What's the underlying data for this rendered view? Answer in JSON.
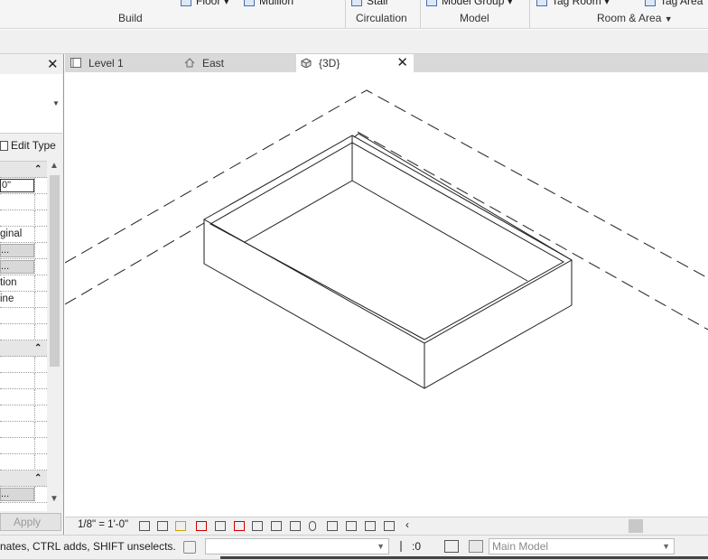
{
  "ribbon": {
    "partial_items": [
      {
        "label": "Floor",
        "icon": "floor-icon",
        "dropdown": true
      },
      {
        "label": "Mullion",
        "icon": "mullion-icon",
        "dropdown": false
      },
      {
        "label": "Stair",
        "icon": "stair-icon",
        "dropdown": false
      },
      {
        "label": "Model Group",
        "icon": "model-group-icon",
        "dropdown": true
      },
      {
        "label": "Tag Room",
        "icon": "tag-room-icon",
        "dropdown": true
      },
      {
        "label": "Tag Area",
        "icon": "tag-area-icon",
        "dropdown": false
      }
    ],
    "panels": {
      "build": "Build",
      "circulation": "Circulation",
      "model": "Model",
      "room_area": "Room & Area"
    }
  },
  "properties": {
    "edit_type_label": "Edit Type",
    "rows": [
      {
        "kind": "header"
      },
      {
        "kind": "input",
        "value": "0\""
      },
      {
        "kind": "text",
        "value": ""
      },
      {
        "kind": "text",
        "value": ""
      },
      {
        "kind": "text",
        "value": "ginal"
      },
      {
        "kind": "button",
        "value": "..."
      },
      {
        "kind": "button",
        "value": "..."
      },
      {
        "kind": "text",
        "value": "tion"
      },
      {
        "kind": "text",
        "value": "ine"
      },
      {
        "kind": "text",
        "value": ""
      },
      {
        "kind": "text",
        "value": ""
      },
      {
        "kind": "header"
      },
      {
        "kind": "text",
        "value": ""
      },
      {
        "kind": "text",
        "value": ""
      },
      {
        "kind": "text",
        "value": ""
      },
      {
        "kind": "text",
        "value": ""
      },
      {
        "kind": "text",
        "value": ""
      },
      {
        "kind": "text",
        "value": ""
      },
      {
        "kind": "text",
        "value": ""
      },
      {
        "kind": "header"
      },
      {
        "kind": "button",
        "value": "..."
      }
    ],
    "apply_label": "Apply"
  },
  "tabs": [
    {
      "label": "Level 1",
      "icon": "floor-plan-icon",
      "active": false
    },
    {
      "label": "East",
      "icon": "elevation-icon",
      "active": false
    },
    {
      "label": "{3D}",
      "icon": "3d-view-icon",
      "active": true
    }
  ],
  "view_control": {
    "scale": "1/8\" = 1'-0\""
  },
  "status": {
    "message": "nates, CTRL adds, SHIFT unselects.",
    "selection_count": ":0",
    "model": "Main Model"
  },
  "colors": {
    "ribbon_bg": "#f5f5f5",
    "tab_bar": "#d9d9d9",
    "panel_bg": "#f0f0f0",
    "line": "#1e1e1e"
  }
}
